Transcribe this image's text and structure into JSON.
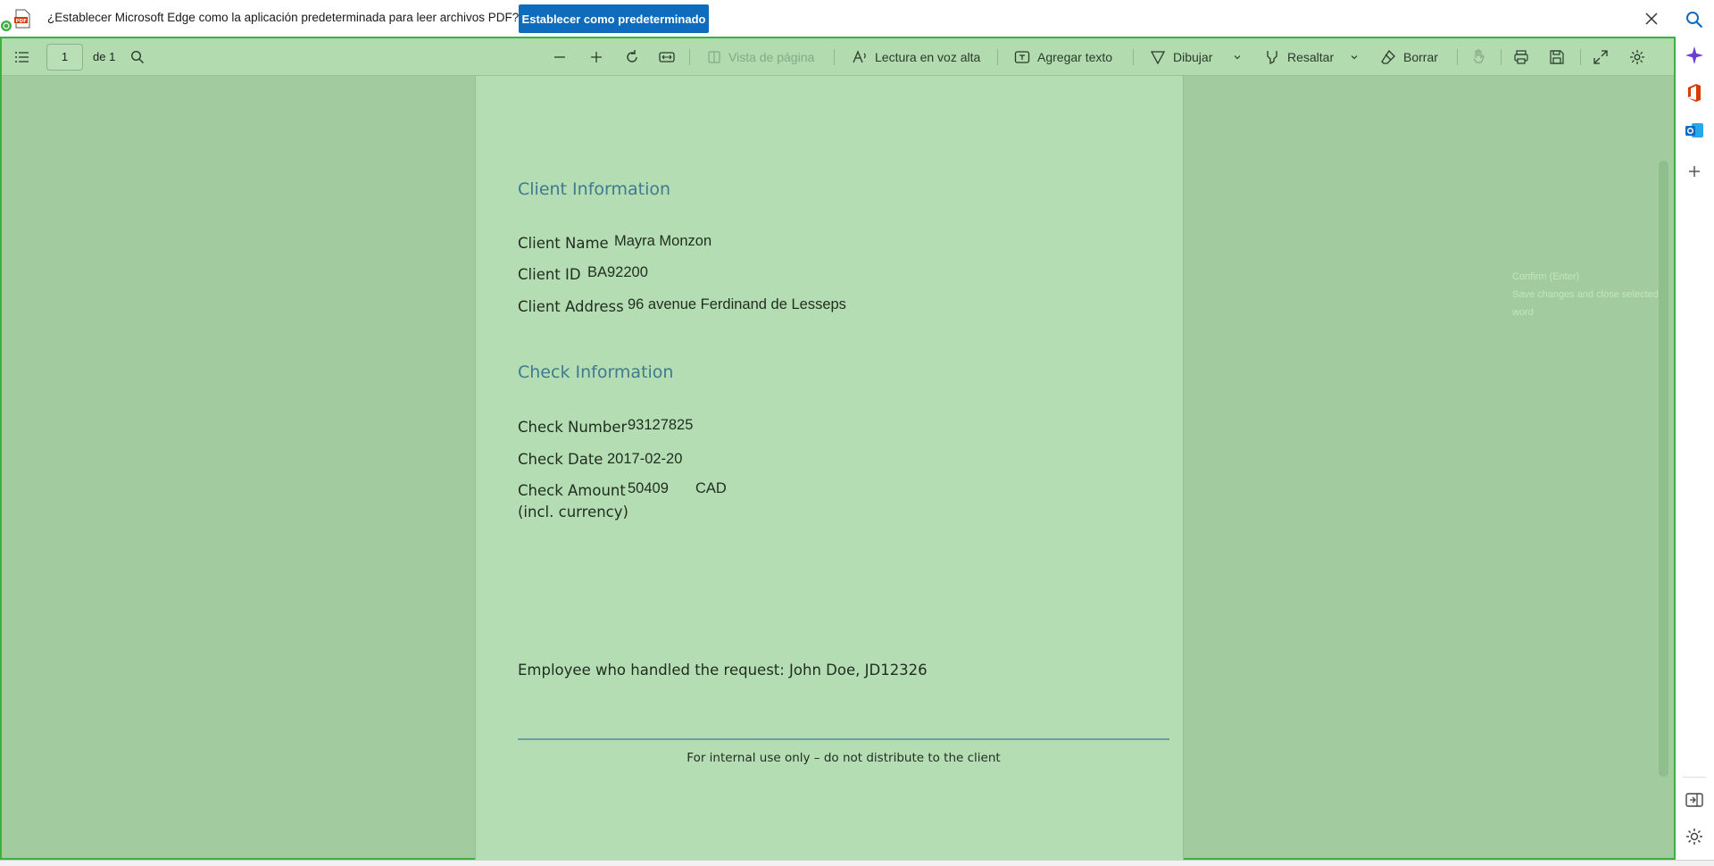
{
  "infobar": {
    "message": "¿Establecer Microsoft Edge como la aplicación predeterminada para leer archivos PDF?",
    "set_default_label": "Establecer como predeterminado"
  },
  "toolbar": {
    "page_number": "1",
    "page_of": "de 1",
    "page_view": "Vista de página",
    "read_aloud": "Lectura en voz alta",
    "add_text": "Agregar texto",
    "draw": "Dibujar",
    "highlight": "Resaltar",
    "erase": "Borrar"
  },
  "document": {
    "client_section_title": "Client Information",
    "client_name_label": "Client Name",
    "client_name": "Mayra Monzon",
    "client_id_label": "Client ID",
    "client_id": "BA92200",
    "client_address_label": "Client Address",
    "client_address": "96 avenue Ferdinand de Lesseps",
    "check_section_title": "Check Information",
    "check_number_label": "Check Number",
    "check_number": "93127825",
    "check_date_label": "Check Date",
    "check_date": "2017-02-20",
    "check_amount_label": "Check Amount",
    "check_amount_sub_label": "(incl. currency)",
    "check_amount": "50409",
    "check_currency": "CAD",
    "employee_line": "Employee who handled the request: John Doe, JD12326",
    "footer": "For internal use only – do not distribute to the client"
  },
  "ghost_tooltip": {
    "line1": "Confirm (Enter)",
    "line2": "Save changes and close selected word"
  },
  "colors": {
    "accent": "#0f6cbd",
    "viewer_bg": "#a3cba0",
    "page_bg": "#b5ddb3",
    "frame_border": "#3cb043",
    "section_title": "#3f7a8e"
  }
}
